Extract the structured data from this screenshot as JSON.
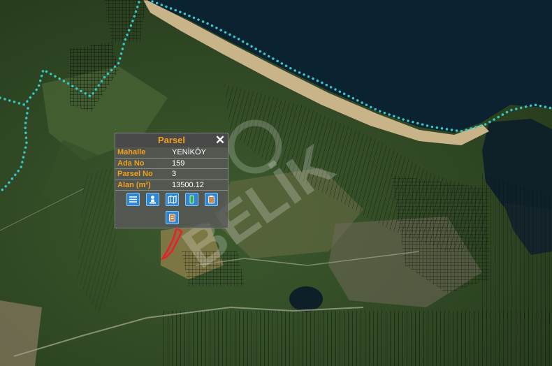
{
  "map": {
    "watermark_text": "BELİK"
  },
  "popup": {
    "title": "Parsel",
    "close_glyph": "✕",
    "rows": [
      {
        "key": "Mahalle",
        "value": "YENİKÖY"
      },
      {
        "key": "Ada No",
        "value": "159"
      },
      {
        "key": "Parsel No",
        "value": "3"
      },
      {
        "key": "Alan (m²)",
        "value": "13500.12"
      }
    ],
    "tools": [
      {
        "icon": "list-icon"
      },
      {
        "icon": "person-icon"
      },
      {
        "icon": "map-icon"
      },
      {
        "icon": "document-icon"
      },
      {
        "icon": "clipboard-icon"
      },
      {
        "icon": "report-icon"
      }
    ]
  },
  "colors": {
    "sea": "#0b2230",
    "boundary": "#35c7c7",
    "parcel_highlight": "#e8202a",
    "accent": "#f0a020",
    "tool_button": "#2f86d0"
  }
}
